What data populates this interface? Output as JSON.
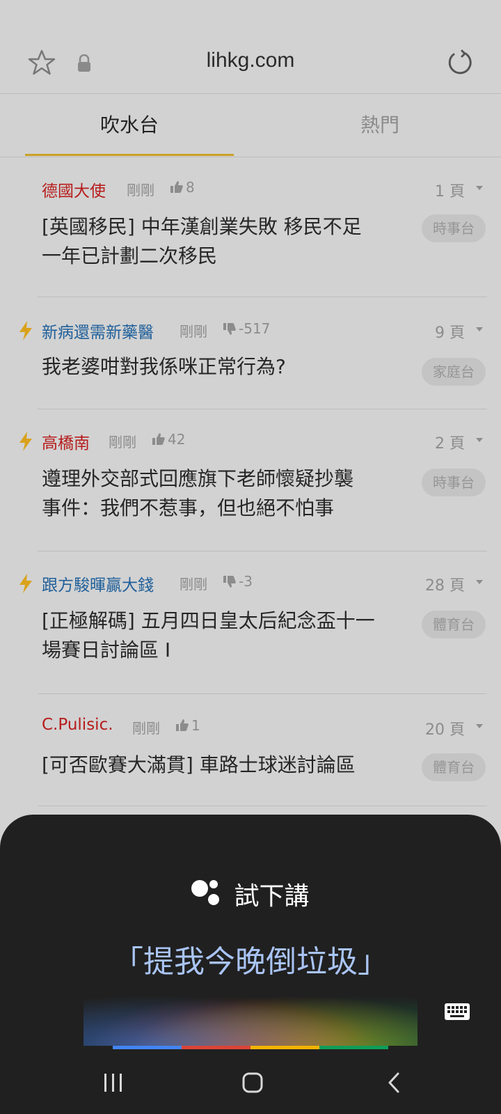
{
  "browser": {
    "url": "lihkg.com"
  },
  "tabs": [
    {
      "label": "吹水台",
      "active": true
    },
    {
      "label": "熱門",
      "active": false
    }
  ],
  "threads": [
    {
      "hot": false,
      "author": "德國大使",
      "author_color": "#b71c1c",
      "time": "剛剛",
      "vote_type": "up",
      "vote": "8",
      "pages": "1 頁",
      "title_lines": [
        "[英國移民] 中年漢創業失敗 移民不足",
        "一年已計劃二次移民"
      ],
      "category": "時事台"
    },
    {
      "hot": true,
      "author": "新病還需新藥醫",
      "author_color": "#1f5f9a",
      "time": "剛剛",
      "vote_type": "down",
      "vote": "-517",
      "pages": "9 頁",
      "title_lines": [
        "我老婆咁對我係咪正常行為?"
      ],
      "category": "家庭台"
    },
    {
      "hot": true,
      "author": "高橋南",
      "author_color": "#b71c1c",
      "time": "剛剛",
      "vote_type": "up",
      "vote": "42",
      "pages": "2 頁",
      "title_lines": [
        "遵理外交部式回應旗下老師懷疑抄襲",
        "事件：我們不惹事，但也絕不怕事"
      ],
      "category": "時事台"
    },
    {
      "hot": true,
      "author": "跟方駿暉贏大錢",
      "author_color": "#1f5f9a",
      "time": "剛剛",
      "vote_type": "down",
      "vote": "-3",
      "pages": "28 頁",
      "title_lines": [
        "[正極解碼] 五月四日皇太后紀念盃十一",
        "場賽日討論區 I"
      ],
      "category": "體育台"
    },
    {
      "hot": false,
      "author": "C.Pulisic.",
      "author_color": "#b71c1c",
      "time": "剛剛",
      "vote_type": "up",
      "vote": "1",
      "pages": "20 頁",
      "title_lines": [
        "[可否歐賽大滿貫] 車路士球迷討論區"
      ],
      "category": "體育台"
    }
  ],
  "assistant": {
    "prompt_label": "試下講",
    "suggestion": "「提我今晚倒垃圾」",
    "brand_colors": [
      "#4285f4",
      "#db4437",
      "#f4b400",
      "#0f9d58"
    ]
  },
  "accent_color": "#c9a227"
}
